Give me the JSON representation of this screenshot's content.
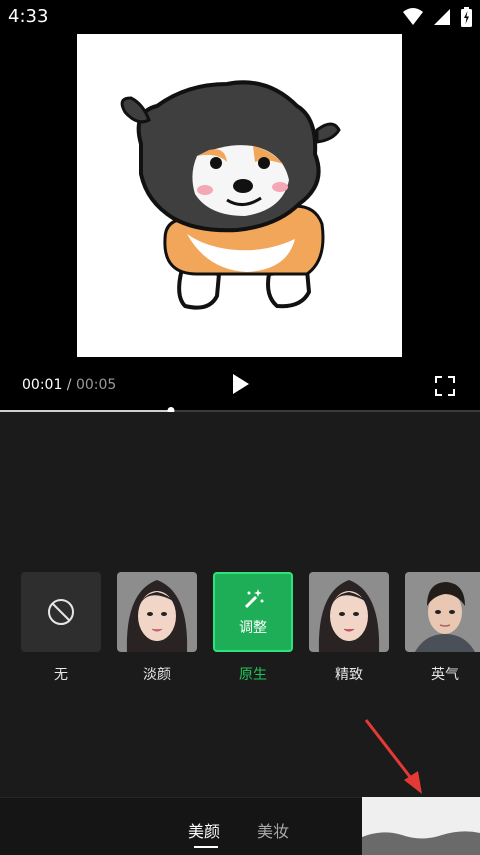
{
  "status": {
    "time": "4:33"
  },
  "player": {
    "current_time": "00:01",
    "separator": " / ",
    "total_time": "00:05",
    "progress": 0.356
  },
  "filters": [
    {
      "label": "无",
      "kind": "none"
    },
    {
      "label": "淡颜",
      "kind": "female"
    },
    {
      "label": "原生",
      "kind": "adjust",
      "badge": "调整",
      "active": true
    },
    {
      "label": "精致",
      "kind": "female"
    },
    {
      "label": "英气",
      "kind": "male"
    }
  ],
  "tabs": {
    "beauty": "美颜",
    "makeup": "美妆"
  },
  "colors": {
    "accent": "#21c45b",
    "panel": "#1b1b1b",
    "annotation_arrow": "#e53935"
  }
}
